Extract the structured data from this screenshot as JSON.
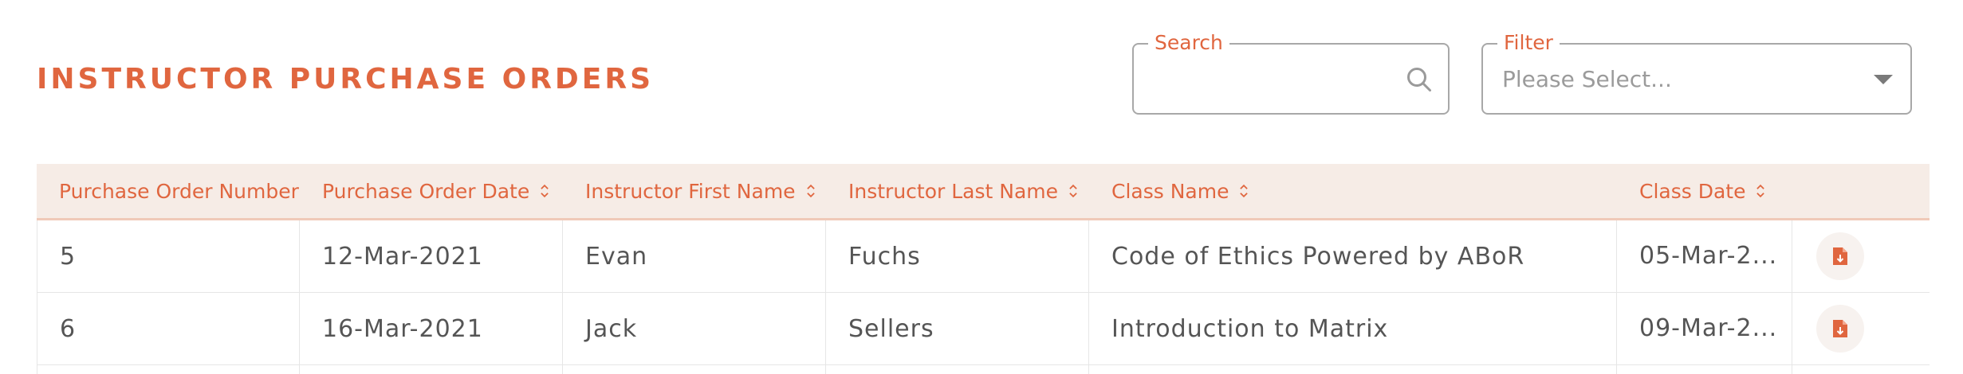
{
  "page": {
    "title": "INSTRUCTOR PURCHASE ORDERS"
  },
  "search": {
    "legend": "Search",
    "value": ""
  },
  "filter": {
    "legend": "Filter",
    "placeholder": "Please Select..."
  },
  "table": {
    "columns": [
      "Purchase Order Number",
      "Purchase Order Date",
      "Instructor First Name",
      "Instructor Last Name",
      "Class Name",
      "Class Date"
    ],
    "rows": [
      {
        "po_number": "5",
        "po_date": "12-Mar-2021",
        "first_name": "Evan",
        "last_name": "Fuchs",
        "class_name": "Code of Ethics Powered by ABoR",
        "class_date": "05-Mar-2..."
      },
      {
        "po_number": "6",
        "po_date": "16-Mar-2021",
        "first_name": "Jack",
        "last_name": "Sellers",
        "class_name": "Introduction to Matrix",
        "class_date": "09-Mar-2..."
      }
    ]
  },
  "colors": {
    "accent": "#e0663f",
    "header_bg": "#f6ece6"
  },
  "icons": {
    "search": "search-icon",
    "sort": "sort-icon",
    "download": "pdf-download-icon",
    "dropdown": "chevron-down-icon"
  }
}
